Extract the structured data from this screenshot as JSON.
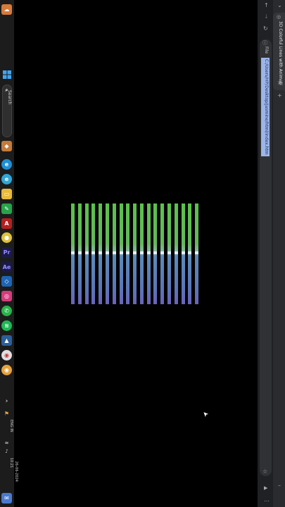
{
  "taskbar": {
    "search_label": "Search",
    "language": "ENG IN",
    "time": "10:21",
    "date": "26-06-2024"
  },
  "browser": {
    "tab_title": "3D Colorful Lines with Animati",
    "file_label": "File",
    "url": "C:/Users/HP/Desktop/Jasmine/html/index.html",
    "close_glyph": "×",
    "new_tab_glyph": "+"
  },
  "viewport": {
    "bar_count": 19
  },
  "colors": {
    "bar_top": "#5ac24a",
    "bar_bottom": "#6a62ba",
    "taskbar_bg": "#1c1c1c",
    "browser_bg": "#202124",
    "url_highlight": "#9cb5ea"
  }
}
